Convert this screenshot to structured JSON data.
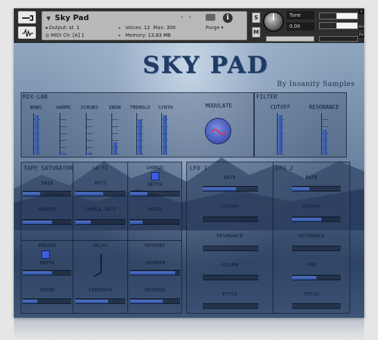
{
  "header": {
    "instrument_name": "Sky Pad",
    "output_label": "Output:",
    "output_value": "st. 1",
    "midi_label": "MIDI Ch:",
    "midi_value": "[A] 1",
    "voices_label": "Voices:",
    "voices_value": "12",
    "max_label": "Max:",
    "max_value": "300",
    "memory_label": "Memory:",
    "memory_value": "13.83 MB",
    "purge_label": "Purge",
    "solo_label": "S",
    "mute_label": "M",
    "tune_label": "Tune",
    "tune_value": "0.00",
    "aux_label": "AUX",
    "pv_label": "PV",
    "close_label": "x",
    "meter_levels": [
      0.45,
      0.45
    ],
    "accent": "#3c5fe0"
  },
  "instrument": {
    "title": "SKY PAD",
    "byline": "By Insanity Samples"
  },
  "mixlab": {
    "label": "MIX-LAB",
    "faders": [
      {
        "label": "BOWS",
        "level": 0.95
      },
      {
        "label": "HARMS",
        "level": 0.05
      },
      {
        "label": "SCRUBS",
        "level": 0.05
      },
      {
        "label": "EBOW",
        "level": 0.3
      },
      {
        "label": "TREMOLO",
        "level": 0.85
      },
      {
        "label": "SYNTH",
        "level": 0.95
      }
    ],
    "modulate_label": "MODULATE"
  },
  "filter": {
    "label": "FILTER",
    "faders": [
      {
        "label": "CUTOFF",
        "level": 0.95
      },
      {
        "label": "RESONANCE",
        "level": 0.6
      }
    ]
  },
  "effects": {
    "tape_label": "TAPE SATURATOR",
    "gain_label": "GAIN",
    "gain": 0.35,
    "warmth_label": "WARMTH",
    "warmth": 0.6,
    "lofi_label": "LO-FI",
    "bits_label": "BITS",
    "bits": 0.55,
    "sample_rate_label": "SAMPLE RATE",
    "sample_rate": 0.3,
    "chorus_label": "CHORUS",
    "chorus_depth_label": "DEPTH",
    "chorus_depth": 0.35,
    "chorus_speed_label": "SPEED",
    "chorus_speed": 0.25,
    "phaser_label": "PHASER",
    "phaser_depth_label": "DEPTH",
    "phaser_depth": 0.6,
    "phaser_speed_label": "SPEED",
    "phaser_speed": 0.3,
    "delay_label": "DELAY",
    "delay_feedback_label": "FEEDBACK",
    "delay_feedback": 0.65,
    "reverbs_label": "REVERBS",
    "shimmer_label": "SHIMMER",
    "shimmer": 0.9,
    "reverse_label": "REVERSE",
    "reverse": 0.65
  },
  "lfo1": {
    "label": "LFO 1",
    "rate_label": "RATE",
    "rate": 0.6,
    "cutoff_label": "CUTOFF",
    "cutoff": 0.0,
    "resonance_label": "RESONANCE",
    "resonance": 0.0,
    "volume_label": "VOLUME",
    "volume": 0.0,
    "pitch_label": "PITCH",
    "pitch": 0.0
  },
  "lfo2": {
    "label": "LFO 2",
    "rate_label": "RATE",
    "rate": 0.35,
    "cutoff_label": "CUTOFF",
    "cutoff": 0.6,
    "resonance_label": "RESONANCE",
    "resonance": 0.0,
    "pan_label": "PAN",
    "pan": 0.5,
    "pitch_label": "PITCH",
    "pitch": 0.0
  }
}
